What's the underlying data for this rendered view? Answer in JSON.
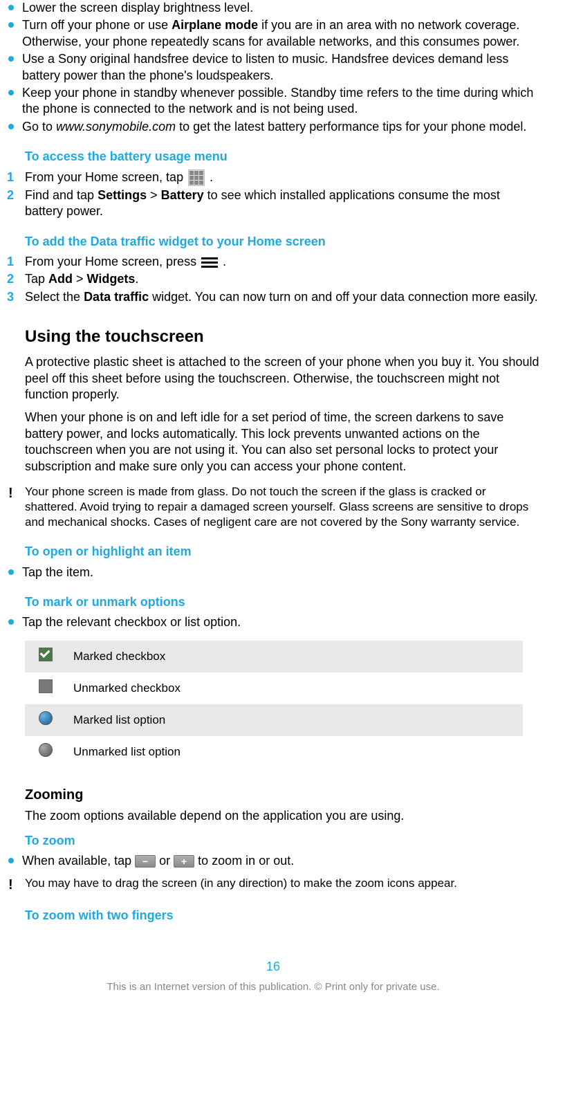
{
  "tips": {
    "brightness": "Lower the screen display brightness level.",
    "airplane_pre": "Turn off your phone or use ",
    "airplane_bold": "Airplane mode",
    "airplane_post": " if you are in an area with no network coverage. Otherwise, your phone repeatedly scans for available networks, and this consumes power.",
    "handsfree": "Use a Sony original handsfree device to listen to music. Handsfree devices demand less battery power than the phone's loudspeakers.",
    "standby": "Keep your phone in standby whenever possible. Standby time refers to the time during which the phone is connected to the network and is not being used.",
    "goto_pre": "Go to ",
    "goto_url": "www.sonymobile.com",
    "goto_post": " to get the latest battery performance tips for your phone model."
  },
  "battery_menu": {
    "heading": "To access the battery usage menu",
    "step1_pre": "From your Home screen, tap ",
    "step1_post": " .",
    "step2_pre": "Find and tap ",
    "step2_b1": "Settings",
    "step2_gt": " > ",
    "step2_b2": "Battery",
    "step2_post": " to see which installed applications consume the most battery power."
  },
  "data_widget": {
    "heading": "To add the Data traffic widget to your Home screen",
    "step1_pre": "From your Home screen, press  ",
    "step1_post": ".",
    "step2_pre": "Tap ",
    "step2_b1": "Add",
    "step2_gt": " > ",
    "step2_b2": "Widgets",
    "step2_post": ".",
    "step3_pre": "Select the ",
    "step3_b": "Data traffic",
    "step3_post": " widget. You can now turn on and off your data connection more easily."
  },
  "touchscreen": {
    "heading": "Using the touchscreen",
    "p1": "A protective plastic sheet is attached to the screen of your phone when you buy it. You should peel off this sheet before using the touchscreen. Otherwise, the touchscreen might not function properly.",
    "p2": "When your phone is on and left idle for a set period of time, the screen darkens to save battery power, and locks automatically. This lock prevents unwanted actions on the touchscreen when you are not using it. You can also set personal locks to protect your subscription and make sure only you can access your phone content.",
    "warn": "Your phone screen is made from glass. Do not touch the screen if the glass is cracked or shattered. Avoid trying to repair a damaged screen yourself. Glass screens are sensitive to drops and mechanical shocks. Cases of negligent care are not covered by the Sony warranty service."
  },
  "open_item": {
    "heading": "To open or highlight an item",
    "bullet": "Tap the item."
  },
  "mark_options": {
    "heading": "To mark or unmark options",
    "bullet": "Tap the relevant checkbox or list option.",
    "rows": {
      "r1": "Marked checkbox",
      "r2": "Unmarked checkbox",
      "r3": "Marked list option",
      "r4": "Unmarked list option"
    }
  },
  "zooming": {
    "heading": "Zooming",
    "p": "The zoom options available depend on the application you are using.",
    "sub": "To zoom",
    "bullet_pre": "When available, tap ",
    "bullet_or": " or ",
    "bullet_post": " to zoom in or out.",
    "warn": "You may have to drag the screen (in any direction) to make the zoom icons appear.",
    "sub2": "To zoom with two fingers"
  },
  "page_number": "16",
  "footer": "This is an Internet version of this publication. © Print only for private use."
}
